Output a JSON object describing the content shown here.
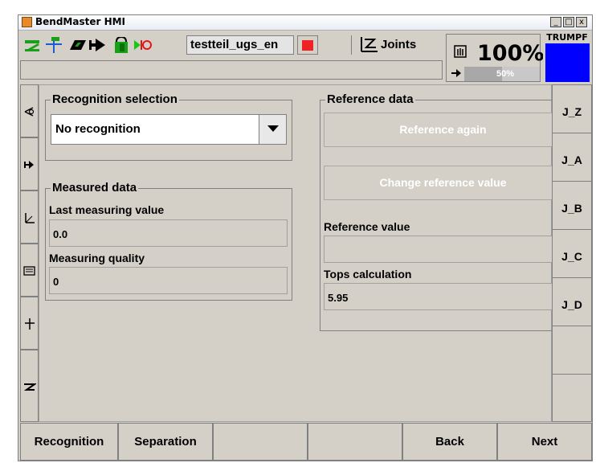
{
  "window": {
    "title": "BendMaster HMI",
    "controls": [
      "_",
      "□",
      "x"
    ]
  },
  "toolbar": {
    "part_name": "testteil_ugs_en",
    "icons": [
      "bend-mode-icon",
      "axis-icon",
      "tool-icon",
      "arrow-right-icon",
      "grip-icon",
      "signal-icon",
      "stop-icon",
      "joints-icon"
    ],
    "joints_label": "Joints",
    "stop_color": "#ee2222"
  },
  "override": {
    "main_percent": "100%",
    "secondary_percent": "50%",
    "secondary_fill": 0.5
  },
  "brand": {
    "name": "TRUMPF",
    "color": "#0000ff"
  },
  "recognition_selection": {
    "title": "Recognition selection",
    "selected": "No recognition"
  },
  "measured_data": {
    "title": "Measured data",
    "last_value_label": "Last measuring value",
    "last_value": "0.0",
    "quality_label": "Measuring quality",
    "quality": "0"
  },
  "reference_data": {
    "title": "Reference data",
    "reference_again": "Reference again",
    "change_reference": "Change reference value",
    "reference_value_label": "Reference value",
    "reference_value": "",
    "tops_label": "Tops calculation",
    "tops_value": "5.95"
  },
  "right_nav": [
    "J_Z",
    "J_A",
    "J_B",
    "J_C",
    "J_D",
    "",
    ""
  ],
  "left_nav_icons": [
    "eye-nav-icon",
    "step-arrow-icon",
    "coordinate-icon",
    "list-icon",
    "plus-axis-icon",
    "bend-icon"
  ],
  "bottom": {
    "recognition": "Recognition",
    "separation": "Separation",
    "empty1": "",
    "empty2": "",
    "back": "Back",
    "next": "Next"
  }
}
